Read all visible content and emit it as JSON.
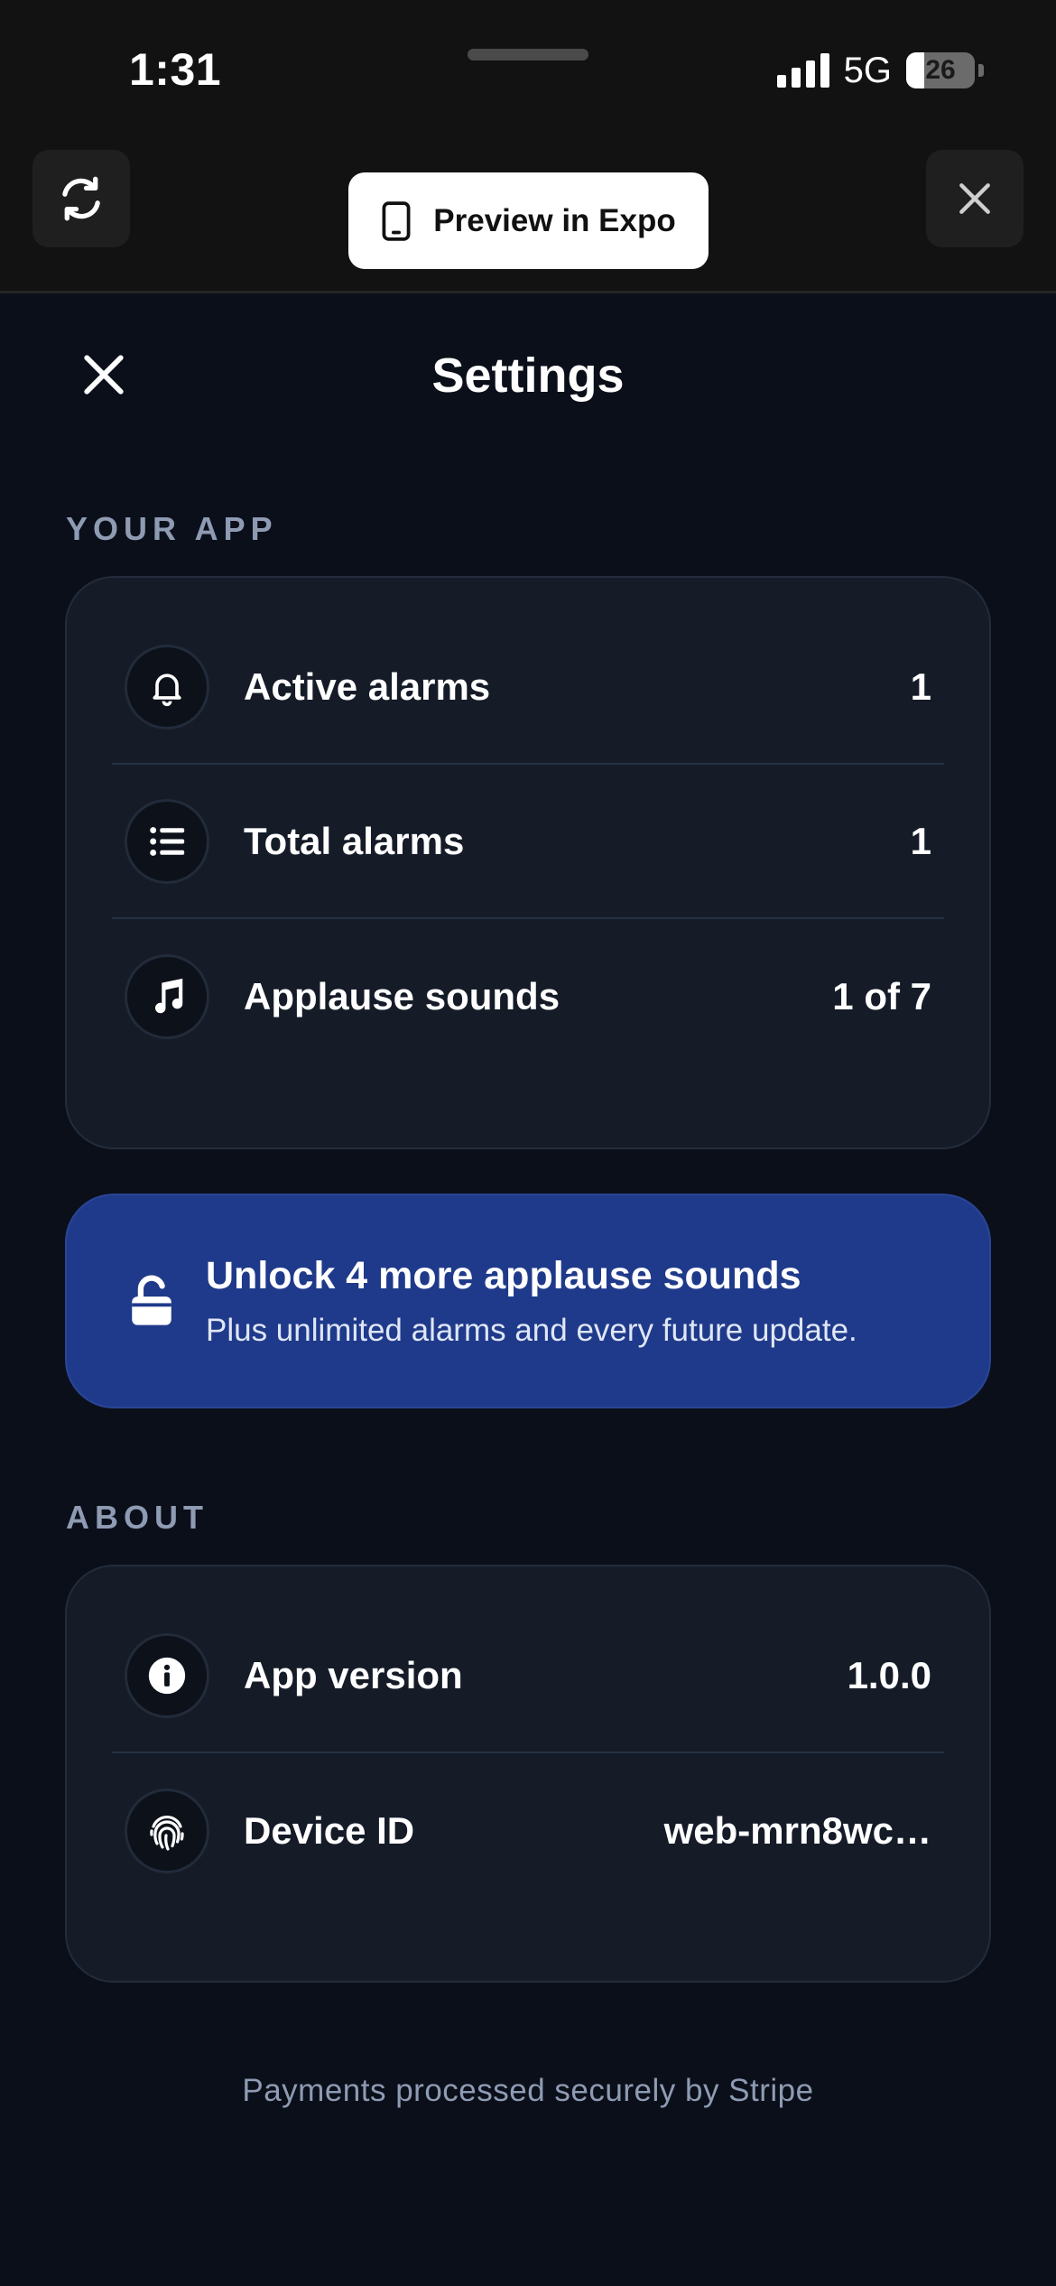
{
  "status_bar": {
    "time": "1:31",
    "network": "5G",
    "battery": "26",
    "battery_level": 0.26
  },
  "chrome": {
    "refresh_icon": "refresh-icon",
    "preview_label": "Preview in Expo",
    "preview_icon": "phone-icon",
    "close_icon": "close-icon"
  },
  "header": {
    "title": "Settings",
    "close_icon": "close-icon"
  },
  "your_app": {
    "section_label": "YOUR APP",
    "rows": [
      {
        "icon": "bell-icon",
        "label": "Active alarms",
        "value": "1"
      },
      {
        "icon": "list-icon",
        "label": "Total alarms",
        "value": "1"
      },
      {
        "icon": "music-note-icon",
        "label": "Applause sounds",
        "value": "1 of 7"
      }
    ]
  },
  "unlock": {
    "icon": "unlock-icon",
    "title": "Unlock 4 more applause sounds",
    "subtitle": "Plus unlimited alarms and every future update."
  },
  "about": {
    "section_label": "ABOUT",
    "rows": [
      {
        "icon": "info-icon",
        "label": "App version",
        "value": "1.0.0"
      },
      {
        "icon": "fingerprint-icon",
        "label": "Device ID",
        "value": "web-mrn8wc…"
      }
    ]
  },
  "footer": {
    "text": "Payments processed securely by Stripe"
  },
  "colors": {
    "background": "#0b0f1a",
    "card": "#151c28",
    "accent_blue": "#1f3a8a",
    "muted_text": "#8e9bb3"
  }
}
